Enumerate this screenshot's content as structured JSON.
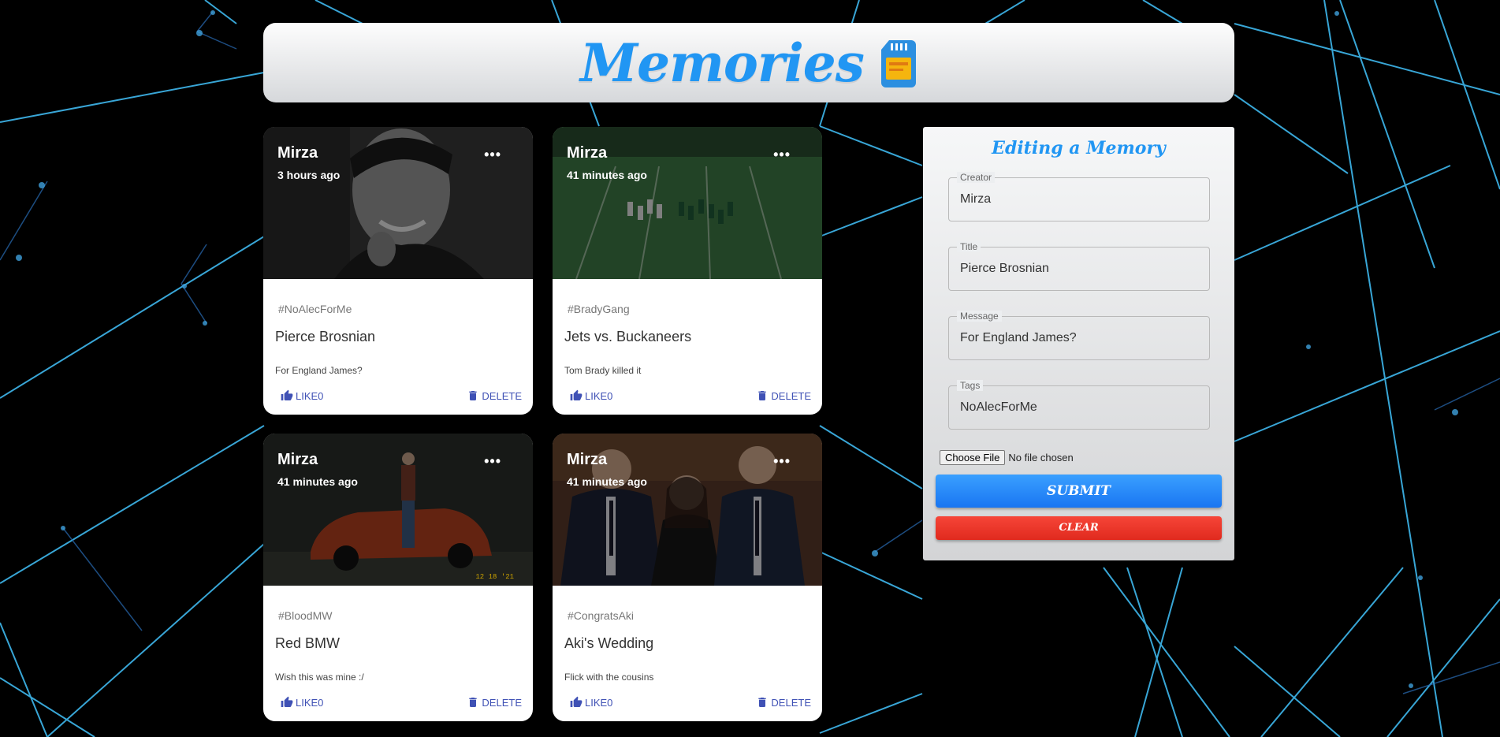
{
  "header": {
    "title": "Memories",
    "logo_icon": "sd-card-icon"
  },
  "posts": [
    {
      "creator": "Mirza",
      "time": "3 hours ago",
      "tags": "#NoAlecForMe",
      "title": "Pierce Brosnian",
      "message": "For England James?",
      "like_label": "LIKE0",
      "delete_label": "DELETE"
    },
    {
      "creator": "Mirza",
      "time": "41 minutes ago",
      "tags": "#BradyGang",
      "title": "Jets vs. Buckaneers",
      "message": "Tom Brady killed it",
      "like_label": "LIKE0",
      "delete_label": "DELETE"
    },
    {
      "creator": "Mirza",
      "time": "41 minutes ago",
      "tags": "#BloodMW",
      "title": "Red BMW",
      "message": "Wish this was mine :/",
      "like_label": "LIKE0",
      "delete_label": "DELETE",
      "photo_date": "12 18 '21"
    },
    {
      "creator": "Mirza",
      "time": "41 minutes ago",
      "tags": "#CongratsAki",
      "title": "Aki's Wedding",
      "message": "Flick with the cousins",
      "like_label": "LIKE0",
      "delete_label": "DELETE"
    }
  ],
  "form": {
    "title": "Editing a Memory",
    "creator": {
      "label": "Creator",
      "value": "Mirza"
    },
    "post_title": {
      "label": "Title",
      "value": "Pierce Brosnian"
    },
    "message": {
      "label": "Message",
      "value": "For England James?"
    },
    "tags": {
      "label": "Tags",
      "value": "NoAlecForMe"
    },
    "file_button": "Choose File",
    "file_status": "No file chosen",
    "submit_label": "SUBMIT",
    "clear_label": "CLEAR"
  },
  "colors": {
    "accent": "#2196f3",
    "submit": "#1e88e5",
    "clear": "#f44336",
    "link": "#3f51b5",
    "network_lines": "#4fc3f7"
  }
}
